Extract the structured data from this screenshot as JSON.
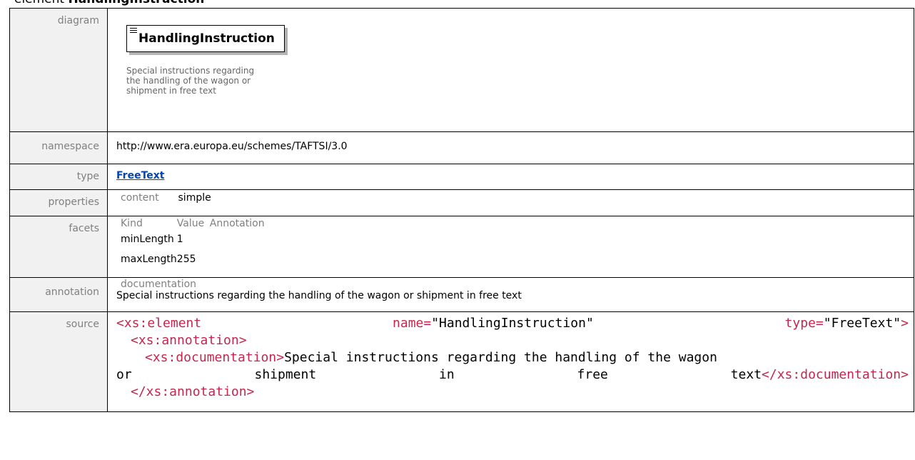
{
  "heading": {
    "prefix": "element ",
    "name": "HandlingInstruction"
  },
  "rows": {
    "diagram": {
      "label": "diagram",
      "element_name": "HandlingInstruction",
      "doc_lines": [
        "Special instructions regarding",
        "the handling of the wagon or",
        "shipment in free text"
      ]
    },
    "namespace": {
      "label": "namespace",
      "value": "http://www.era.europa.eu/schemes/TAFTSI/3.0"
    },
    "type": {
      "label": "type",
      "value": "FreeText"
    },
    "properties": {
      "label": "properties",
      "key": "content",
      "value": "simple"
    },
    "facets": {
      "label": "facets",
      "headers": [
        "Kind",
        "Value",
        "Annotation"
      ],
      "items": [
        {
          "kind": "minLength",
          "value": "1"
        },
        {
          "kind": "maxLength",
          "value": "255"
        }
      ]
    },
    "annotation": {
      "label": "annotation",
      "sub": "documentation",
      "text": "Special instructions regarding the handling of the wagon or shipment in free text"
    },
    "source": {
      "label": "source",
      "line1": {
        "open": "<xs:element",
        "attr1": "name=",
        "val1": "\"HandlingInstruction\"",
        "attr2": "type=",
        "val2": "\"FreeText\"",
        "close": ">"
      },
      "line2": "<xs:annotation>",
      "line3": {
        "open": "<xs:documentation>",
        "text": "Special instructions regarding the handling of the wagon"
      },
      "line4": {
        "w1": "or",
        "w2": "shipment",
        "w3": "in",
        "w4": "free",
        "w5": "text",
        "close": "</xs:documentation>"
      },
      "line5": "</xs:annotation>"
    }
  }
}
